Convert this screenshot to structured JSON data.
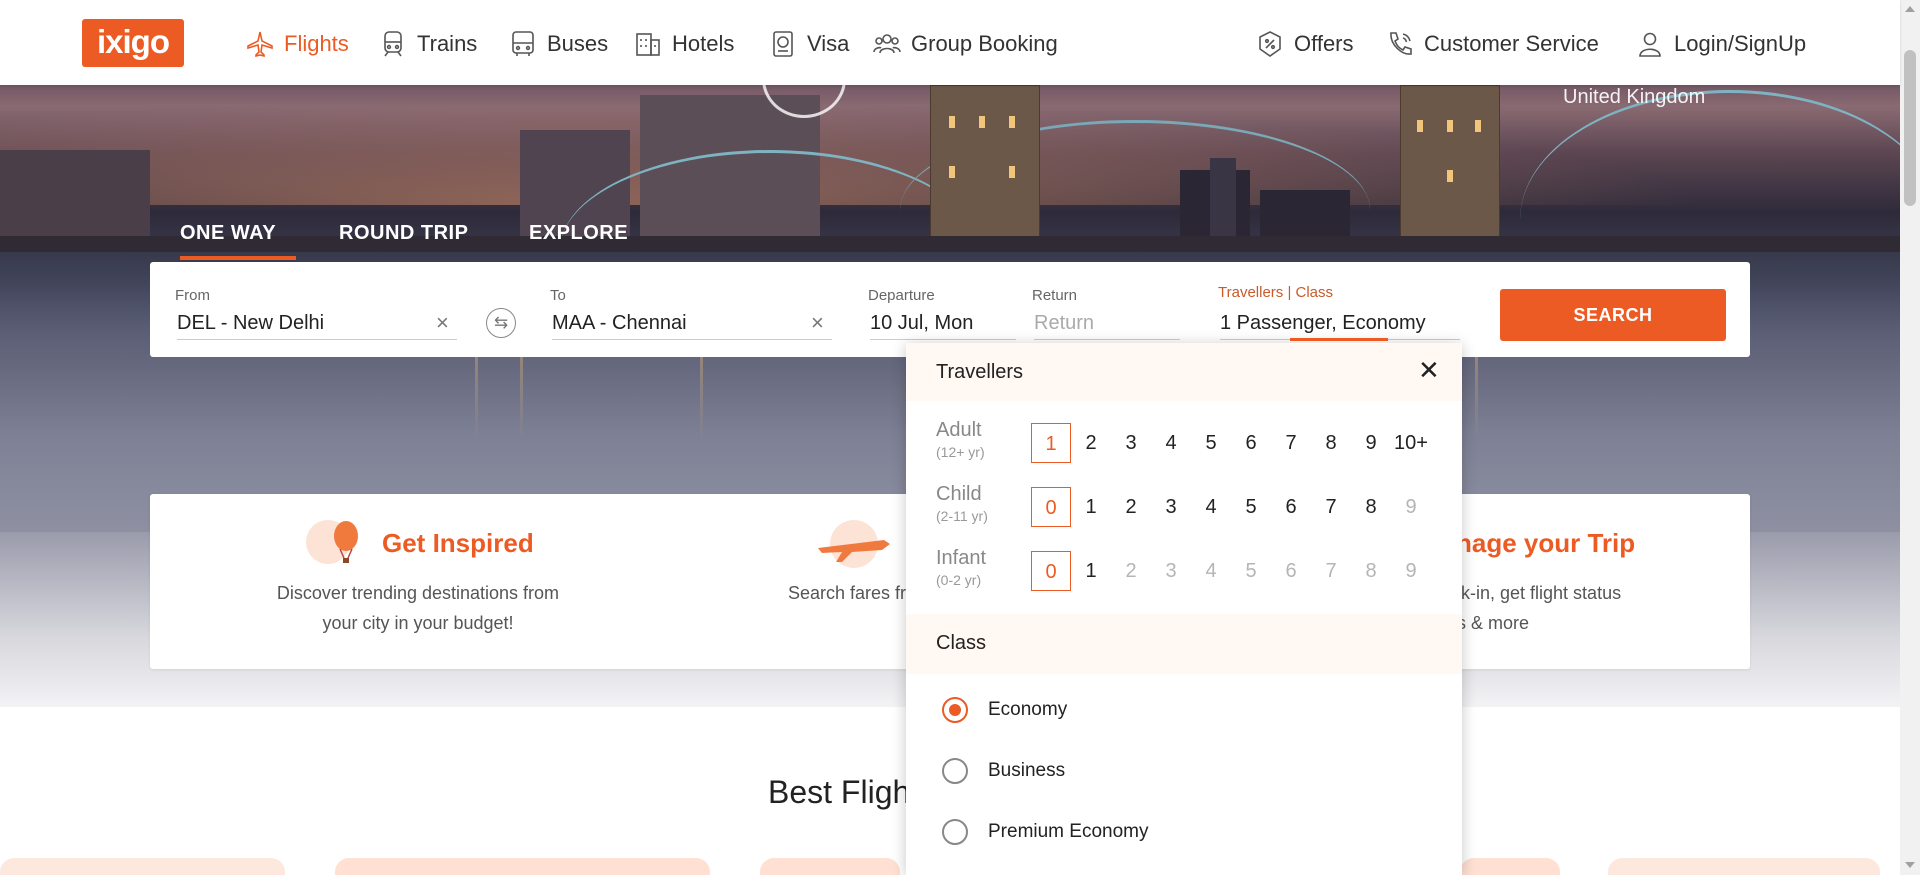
{
  "brand": {
    "logo_text": "ixigo",
    "accent": "#ec5b24"
  },
  "nav": {
    "items": [
      {
        "label": "Flights",
        "icon": "plane-icon",
        "active": true
      },
      {
        "label": "Trains",
        "icon": "train-icon"
      },
      {
        "label": "Buses",
        "icon": "bus-icon"
      },
      {
        "label": "Hotels",
        "icon": "hotel-icon"
      },
      {
        "label": "Visa",
        "icon": "passport-icon"
      },
      {
        "label": "Group Booking",
        "icon": "group-icon"
      }
    ],
    "right": [
      {
        "label": "Offers",
        "icon": "offer-tag-icon"
      },
      {
        "label": "Customer Service",
        "icon": "phone-icon"
      },
      {
        "label": "Login/SignUp",
        "icon": "user-icon"
      }
    ]
  },
  "hero": {
    "caption": "United Kingdom"
  },
  "trip_tabs": [
    {
      "label": "ONE WAY",
      "active": true
    },
    {
      "label": "ROUND TRIP"
    },
    {
      "label": "EXPLORE"
    }
  ],
  "search": {
    "from_label": "From",
    "from_value": "DEL - New Delhi",
    "to_label": "To",
    "to_value": "MAA - Chennai",
    "departure_label": "Departure",
    "departure_value": "10 Jul, Mon",
    "return_label": "Return",
    "return_placeholder": "Return",
    "travellers_label": "Travellers | Class",
    "travellers_value": "1 Passenger, Economy",
    "search_label": "SEARCH"
  },
  "features": [
    {
      "title": "Get Inspired",
      "desc_line1": "Discover trending destinations from",
      "desc_line2": "your city in your budget!"
    },
    {
      "title_visible": "",
      "desc_line1": "Search fares fr"
    },
    {
      "title": "nage your Trip",
      "desc_line1": "ck-in, get flight status",
      "desc_line2": "ts & more"
    }
  ],
  "section_title": "Best Flight",
  "travellers_popup": {
    "title": "Travellers",
    "rows": [
      {
        "label": "Adult",
        "sub": "(12+ yr)",
        "options": [
          "1",
          "2",
          "3",
          "4",
          "5",
          "6",
          "7",
          "8",
          "9",
          "10+"
        ],
        "selected": "1",
        "disabled_from": null
      },
      {
        "label": "Child",
        "sub": "(2-11 yr)",
        "options": [
          "0",
          "1",
          "2",
          "3",
          "4",
          "5",
          "6",
          "7",
          "8",
          "9"
        ],
        "selected": "0",
        "disabled_from": 9
      },
      {
        "label": "Infant",
        "sub": "(0-2 yr)",
        "options": [
          "0",
          "1",
          "2",
          "3",
          "4",
          "5",
          "6",
          "7",
          "8",
          "9"
        ],
        "selected": "0",
        "disabled_from": 2
      }
    ],
    "class_title": "Class",
    "classes": [
      {
        "label": "Economy",
        "checked": true
      },
      {
        "label": "Business",
        "checked": false
      },
      {
        "label": "Premium Economy",
        "checked": false
      }
    ]
  }
}
